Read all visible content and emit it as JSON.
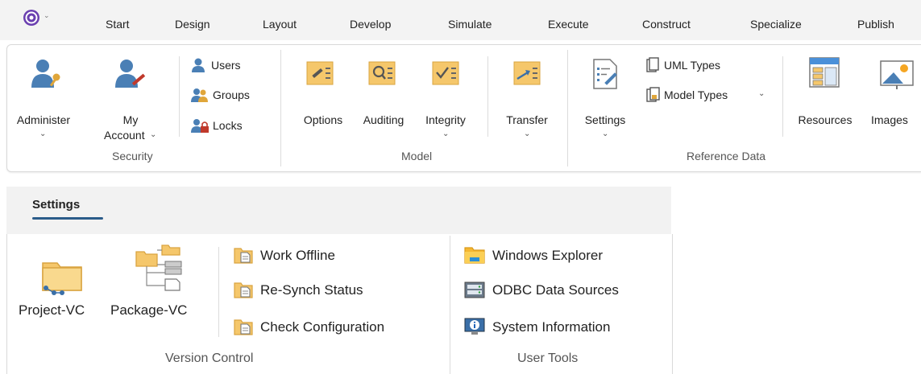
{
  "menubar": {
    "app_icon": "enterprise-architect-logo-icon",
    "tabs": [
      "Start",
      "Design",
      "Layout",
      "Develop",
      "Simulate",
      "Execute",
      "Construct",
      "Specialize",
      "Publish"
    ]
  },
  "ribbon": {
    "security": {
      "administer": "Administer",
      "my_account_line1": "My",
      "my_account_line2": "Account",
      "users": "Users",
      "groups": "Groups",
      "locks": "Locks",
      "group_label": "Security"
    },
    "model": {
      "options": "Options",
      "auditing": "Auditing",
      "integrity": "Integrity",
      "transfer": "Transfer",
      "group_label": "Model"
    },
    "reference_data": {
      "settings": "Settings",
      "uml_types": "UML Types",
      "model_types": "Model Types",
      "resources": "Resources",
      "images": "Images",
      "group_label": "Reference Data"
    }
  },
  "settings_panel": {
    "tab_label": "Settings",
    "version_control": {
      "project_vc": "Project-VC",
      "package_vc": "Package-VC",
      "work_offline": "Work Offline",
      "resynch_status": "Re-Synch Status",
      "check_configuration": "Check Configuration",
      "group_label": "Version Control"
    },
    "user_tools": {
      "windows_explorer": "Windows Explorer",
      "odbc_data_sources": "ODBC Data Sources",
      "system_information": "System Information",
      "group_label": "User Tools"
    }
  },
  "colors": {
    "accent": "#2b5c8a",
    "folder": "#f5c76b",
    "user_blue": "#4a7fb5"
  }
}
